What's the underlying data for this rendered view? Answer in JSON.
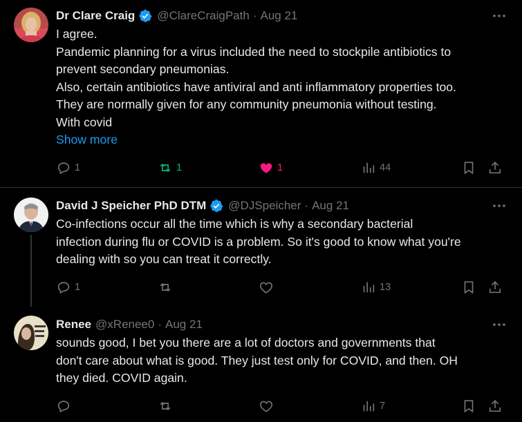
{
  "tweets": [
    {
      "author": "Dr Clare Craig",
      "handle": "@ClareCraigPath",
      "dot": "·",
      "time": "Aug 21",
      "verified": true,
      "lines": [
        "I agree.",
        "Pandemic planning for a virus included the need to stockpile antibiotics to",
        "prevent secondary pneumonias.",
        "Also, certain antibiotics have antiviral and anti inflammatory properties too.",
        "They are normally given for any community pneumonia without testing.",
        "With covid"
      ],
      "show_more": "Show more",
      "replies": "1",
      "retweets": "1",
      "likes": "1",
      "views": "44",
      "avatar_colors": {
        "bg": "#b84a4a",
        "hair": "#d9b36a",
        "skin": "#e8c2a8"
      }
    },
    {
      "author": "David J Speicher PhD DTM",
      "handle": "@DJSpeicher",
      "dot": "·",
      "time": "Aug 21",
      "verified": true,
      "lines": [
        "Co-infections occur all the time which is why a secondary bacterial",
        "infection during flu or COVID is a problem. So it's good to know what you're",
        "dealing with so you can treat it correctly."
      ],
      "replies": "1",
      "retweets": "",
      "likes": "",
      "views": "13",
      "avatar_colors": {
        "bg": "#7c8a96",
        "suit": "#1e2a3a",
        "skin": "#d9b39a"
      }
    },
    {
      "author": "Renee",
      "handle": "@xRenee0",
      "dot": "·",
      "time": "Aug 21",
      "verified": false,
      "lines": [
        "sounds good, I bet you there are a lot of doctors and governments that",
        "don't care about what is good. They just test only for COVID, and then. OH",
        "they died. COVID again."
      ],
      "replies": "",
      "retweets": "",
      "likes": "",
      "views": "7",
      "avatar_colors": {
        "bg": "#e8e0c8",
        "hair": "#3a2a1e"
      }
    }
  ],
  "colors": {
    "verified_blue": "#1d9bf0",
    "retweet_green": "#00ba7c",
    "like_pink": "#f91880",
    "muted": "#71767b"
  }
}
